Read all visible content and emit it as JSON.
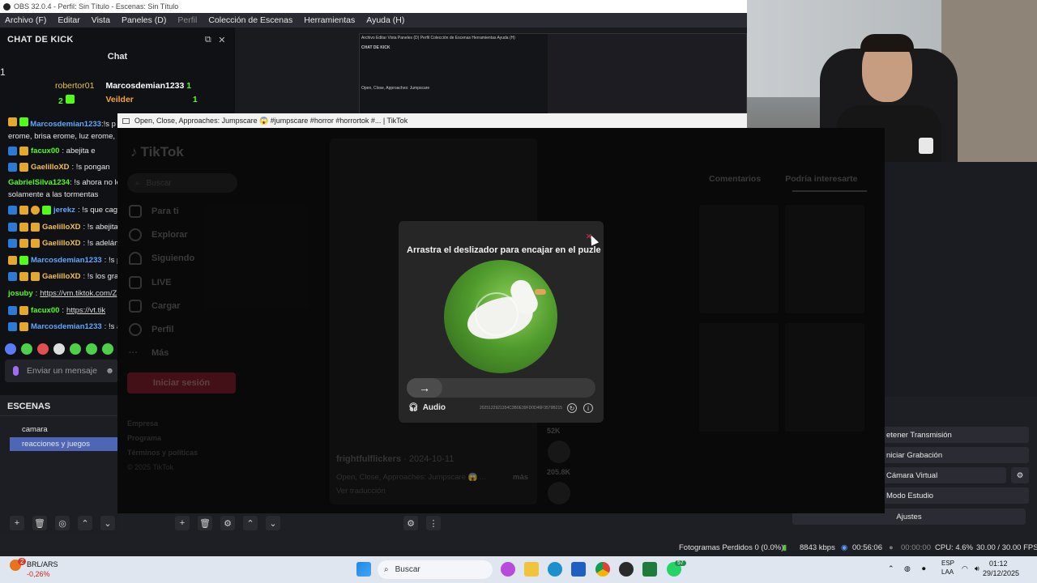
{
  "obs": {
    "title": "OBS 32.0.4 - Perfil: Sin Título - Escenas: Sin Título",
    "menu": [
      "Archivo (F)",
      "Editar",
      "Vista",
      "Paneles (D)",
      "Perfil",
      "Colección de Escenas",
      "Herramientas",
      "Ayuda (H)"
    ]
  },
  "kick": {
    "dock_title": "CHAT DE KICK",
    "subtitle": "Chat",
    "leaders": {
      "rank1": "1",
      "user1": "robertor01",
      "user1_count": "2",
      "user2": "Marcosdemian1233",
      "user2_count": "1",
      "user3": "Veilder",
      "user3_count": "1"
    },
    "messages": [
      {
        "user": "Marcosdemian1233",
        "text": ":!s p",
        "cont": "erome, brisa erome, luz erome, s"
      },
      {
        "user": "facux00",
        "text": ": abejita e"
      },
      {
        "user": "GaelilloXD",
        "text": ": !s pongan"
      },
      {
        "user": "GabrielSilva1234",
        "text": ": !s ahora no le",
        "cont": "solamente a las tormentas"
      },
      {
        "user": "jerekz",
        "text": ": !s que cag"
      },
      {
        "user": "GaelilloXD",
        "text": ": !s abejita"
      },
      {
        "user": "GaelilloXD",
        "text": ": !s adelánt"
      },
      {
        "user": "Marcosdemian1233",
        "text": ": !s p"
      },
      {
        "user": "GaelilloXD",
        "text": ": !s los gran"
      },
      {
        "user": "josuby",
        "text": "https://vm.tiktok.com/Z"
      },
      {
        "user": "facux00",
        "text": "https://vt.tik"
      },
      {
        "user": "Marcosdemian1233",
        "text": ": !s a"
      }
    ],
    "input_placeholder": "Enviar un mensaje"
  },
  "scenes": {
    "title": "ESCENAS",
    "items": [
      "camara",
      "reacciones y juegos"
    ]
  },
  "controls": {
    "items": [
      "etener Transmisión",
      "niciar Grabación",
      "Cámara Virtual",
      "Modo Estudio",
      "Ajustes"
    ]
  },
  "status": {
    "frames": "Fotogramas Perdidos 0 (0.0%)",
    "kbps": "8843 kbps",
    "stream_time": "00:56:06",
    "rec_time": "00:00:00",
    "cpu": "CPU: 4.6%",
    "fps": "30.00 / 30.00 FPS"
  },
  "preview_thumb": {
    "menu": "Archivo  Editar  Vista  Paneles (D)  Perfil  Colección de Escenas  Herramientas  Ayuda (H)",
    "chat_title": "CHAT DE KICK",
    "tab_title": "Open, Close, Approaches: Jumpscare"
  },
  "tiktok": {
    "window_title": "Open, Close, Approaches: Jumpscare 😱 #jumpscare #horror #horrortok #... | TikTok",
    "logo": "TikTok",
    "search_placeholder": "Buscar",
    "nav": [
      "Para ti",
      "Explorar",
      "Siguiendo",
      "LIVE",
      "Cargar",
      "Perfil",
      "Más"
    ],
    "login": "Iniciar sesión",
    "footer": [
      "Empresa",
      "Programa",
      "Términos y políticas",
      "© 2025 TikTok"
    ],
    "video_author": "frightfulflickers",
    "video_date": "· 2024-10-11",
    "video_desc": "Open, Close, Approaches: Jumpscare 😱 ...",
    "more": "más",
    "translate": "Ver traducción",
    "stats": [
      "52K",
      "205.8K"
    ],
    "tabs": [
      "Comentarios",
      "Podría interesarte"
    ]
  },
  "captcha": {
    "title": "Arrastra el deslizador para encajar en el puzle",
    "close": "×",
    "audio": "Audio",
    "code": "2025122921354C3B0E39FD0D46F3579B215",
    "arrow": "→"
  },
  "taskbar": {
    "search": "Buscar",
    "currency": "BRL/ARS",
    "currency_change": "-0,26%",
    "badge": "2",
    "lang": "ESP",
    "lang2": "LAA",
    "time": "01:12",
    "date": "29/12/2025",
    "whatsapp_badge": "57"
  }
}
